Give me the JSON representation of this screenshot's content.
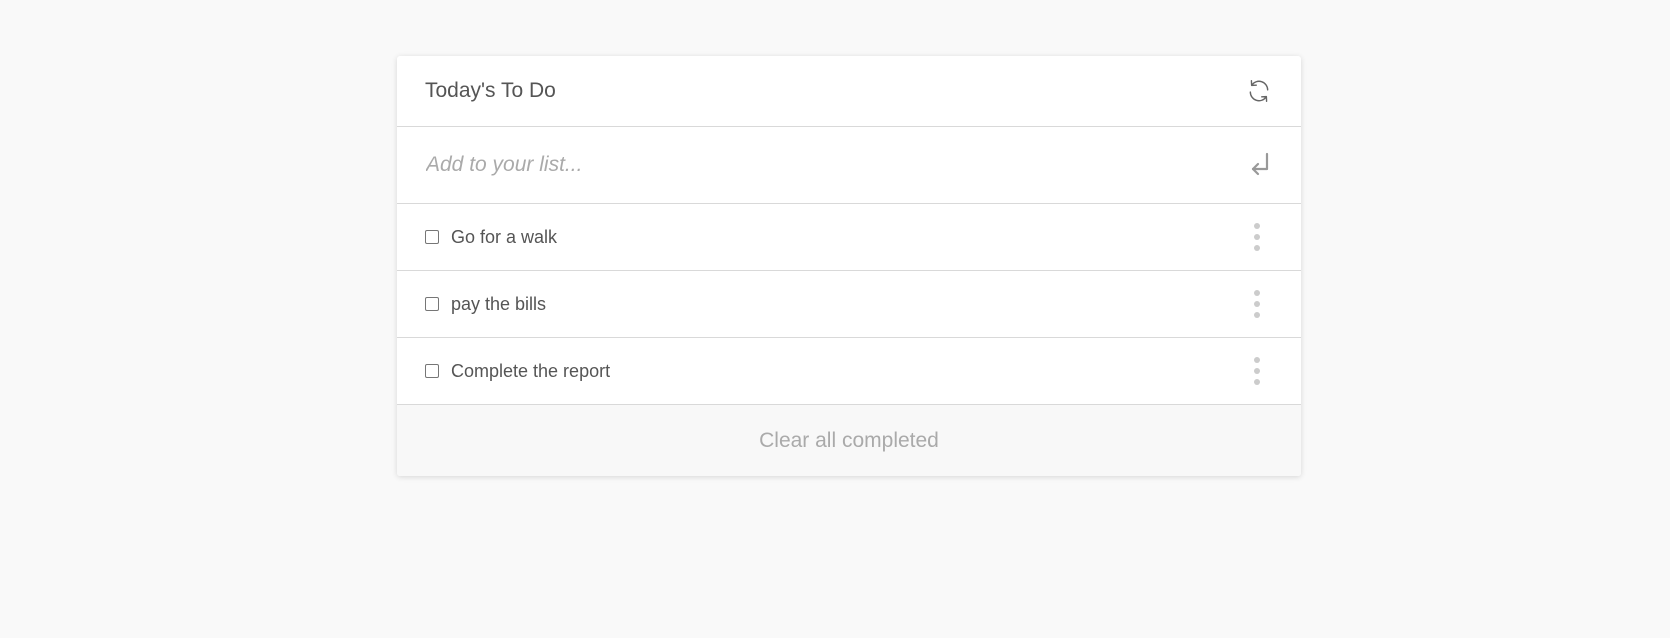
{
  "header": {
    "title": "Today's To Do",
    "refresh_icon": "refresh-icon"
  },
  "add": {
    "placeholder": "Add to your list...",
    "value": "",
    "submit_icon": "enter-return-icon"
  },
  "items": [
    {
      "label": "Go for a walk",
      "checked": false
    },
    {
      "label": "pay the bills",
      "checked": false
    },
    {
      "label": "Complete the report",
      "checked": false
    }
  ],
  "footer": {
    "clear_label": "Clear all completed"
  },
  "colors": {
    "background": "#f9f9f9",
    "card": "#ffffff",
    "text": "#555555",
    "muted": "#aaaaaa",
    "divider": "#d9d9d9",
    "footer_bg": "#f8f8f8"
  }
}
